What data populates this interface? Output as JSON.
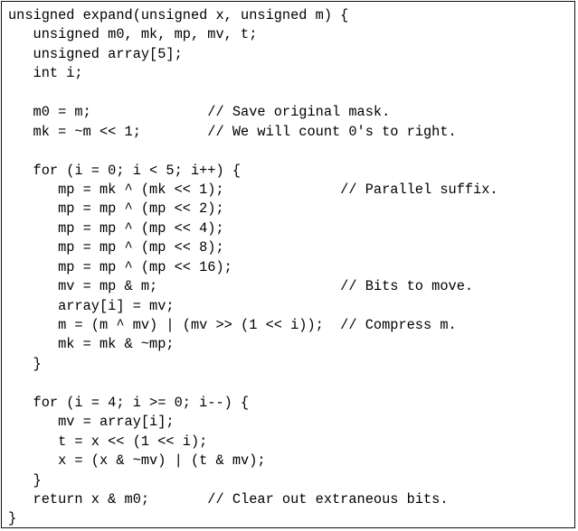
{
  "code": {
    "lines": [
      "unsigned expand(unsigned x, unsigned m) {",
      "   unsigned m0, mk, mp, mv, t;",
      "   unsigned array[5];",
      "   int i;",
      "",
      "   m0 = m;              // Save original mask.",
      "   mk = ~m << 1;        // We will count 0's to right.",
      "",
      "   for (i = 0; i < 5; i++) {",
      "      mp = mk ^ (mk << 1);              // Parallel suffix.",
      "      mp = mp ^ (mp << 2);",
      "      mp = mp ^ (mp << 4);",
      "      mp = mp ^ (mp << 8);",
      "      mp = mp ^ (mp << 16);",
      "      mv = mp & m;                      // Bits to move.",
      "      array[i] = mv;",
      "      m = (m ^ mv) | (mv >> (1 << i));  // Compress m.",
      "      mk = mk & ~mp;",
      "   }",
      "",
      "   for (i = 4; i >= 0; i--) {",
      "      mv = array[i];",
      "      t = x << (1 << i);",
      "      x = (x & ~mv) | (t & mv);",
      "   }",
      "   return x & m0;       // Clear out extraneous bits.",
      "}"
    ]
  }
}
